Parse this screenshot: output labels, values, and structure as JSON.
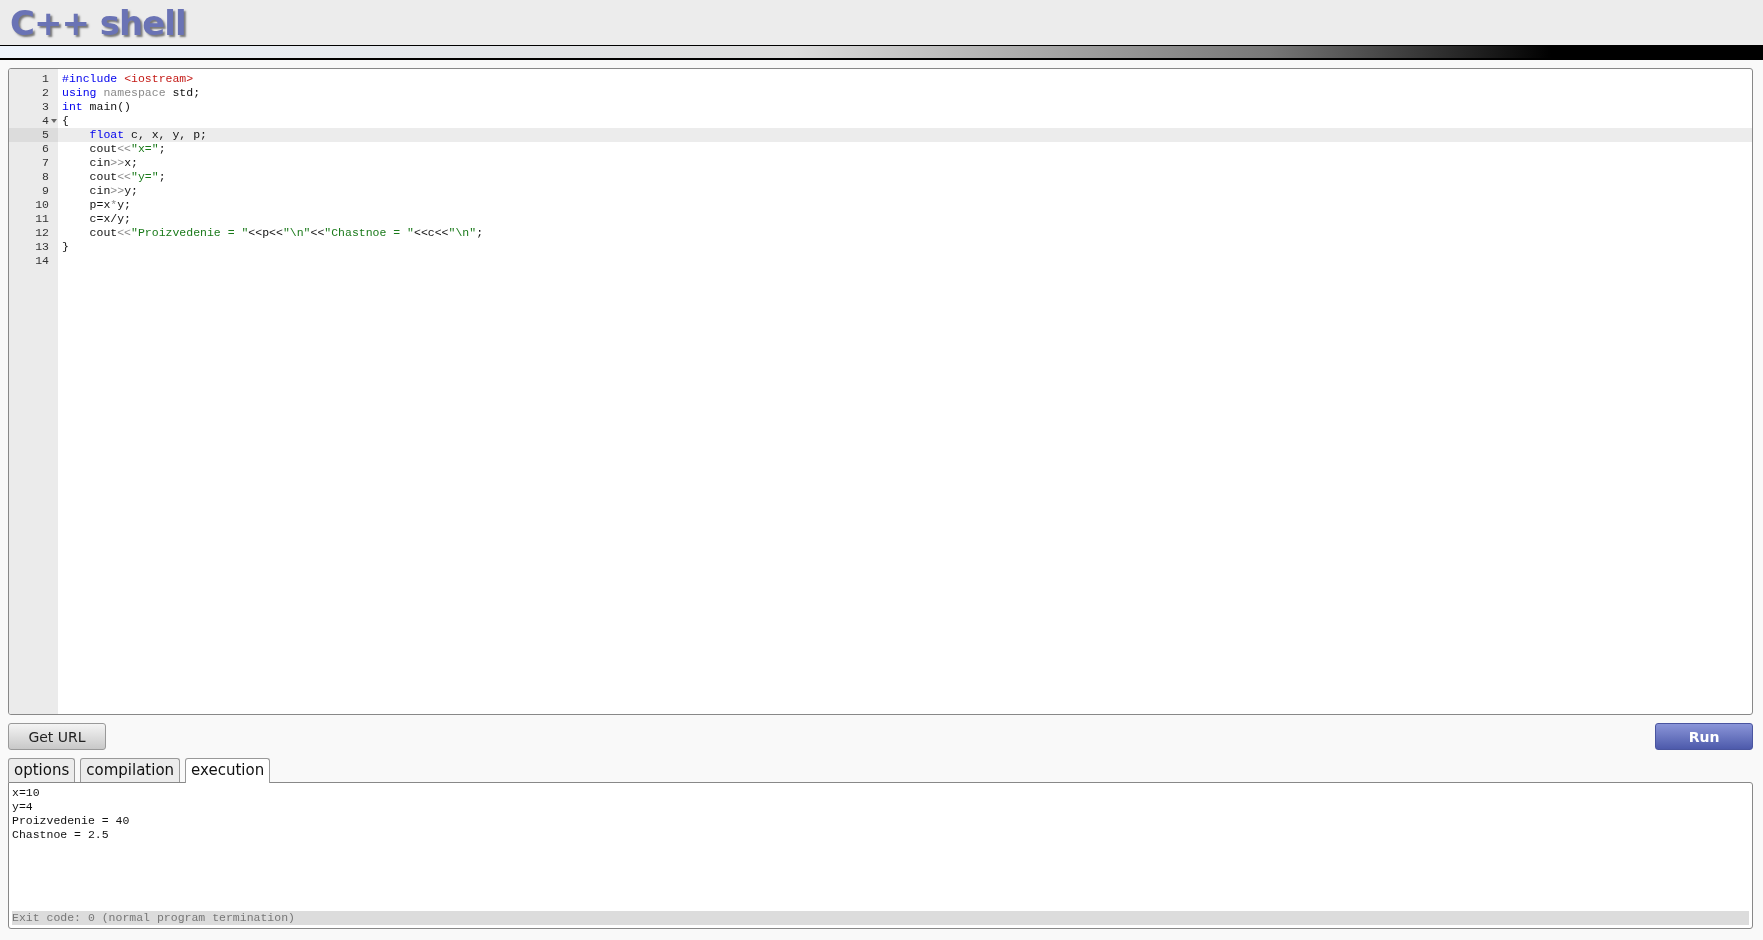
{
  "header": {
    "logo": "C++ shell"
  },
  "editor": {
    "lines": [
      {
        "number": "1",
        "kind": "plain",
        "active": false,
        "tokens": [
          {
            "kind": "keyword",
            "text": "#include "
          },
          {
            "kind": "header",
            "text": "<iostream>"
          }
        ]
      },
      {
        "number": "2",
        "kind": "plain",
        "active": false,
        "tokens": [
          {
            "kind": "keyword",
            "text": "using "
          },
          {
            "kind": "dim",
            "text": "namespace "
          },
          {
            "kind": "plain",
            "text": "std;"
          }
        ]
      },
      {
        "number": "3",
        "kind": "plain",
        "active": false,
        "tokens": [
          {
            "kind": "keyword",
            "text": "int "
          },
          {
            "kind": "plain",
            "text": "main()"
          }
        ]
      },
      {
        "number": "4",
        "kind": "fold",
        "active": false,
        "tokens": [
          {
            "kind": "plain",
            "text": "{"
          }
        ]
      },
      {
        "number": "5",
        "kind": "plain",
        "active": true,
        "tokens": [
          {
            "kind": "keyword",
            "text": "    float "
          },
          {
            "kind": "plain",
            "text": "c, x, y, p;"
          }
        ]
      },
      {
        "number": "6",
        "kind": "plain",
        "active": false,
        "tokens": [
          {
            "kind": "plain",
            "text": "    cout"
          },
          {
            "kind": "dim",
            "text": "<<"
          },
          {
            "kind": "string",
            "text": "\"x=\""
          },
          {
            "kind": "plain",
            "text": ";"
          }
        ]
      },
      {
        "number": "7",
        "kind": "plain",
        "active": false,
        "tokens": [
          {
            "kind": "plain",
            "text": "    cin"
          },
          {
            "kind": "dim",
            "text": ">>"
          },
          {
            "kind": "plain",
            "text": "x;"
          }
        ]
      },
      {
        "number": "8",
        "kind": "plain",
        "active": false,
        "tokens": [
          {
            "kind": "plain",
            "text": "    cout"
          },
          {
            "kind": "dim",
            "text": "<<"
          },
          {
            "kind": "string",
            "text": "\"y=\""
          },
          {
            "kind": "plain",
            "text": ";"
          }
        ]
      },
      {
        "number": "9",
        "kind": "plain",
        "active": false,
        "tokens": [
          {
            "kind": "plain",
            "text": "    cin"
          },
          {
            "kind": "dim",
            "text": ">>"
          },
          {
            "kind": "plain",
            "text": "y;"
          }
        ]
      },
      {
        "number": "10",
        "kind": "plain",
        "active": false,
        "tokens": [
          {
            "kind": "plain",
            "text": "    p=x"
          },
          {
            "kind": "dim",
            "text": "*"
          },
          {
            "kind": "plain",
            "text": "y;"
          }
        ]
      },
      {
        "number": "11",
        "kind": "plain",
        "active": false,
        "tokens": [
          {
            "kind": "plain",
            "text": "    c=x/y;"
          }
        ]
      },
      {
        "number": "12",
        "kind": "plain",
        "active": false,
        "tokens": [
          {
            "kind": "plain",
            "text": "    cout"
          },
          {
            "kind": "dim",
            "text": "<<"
          },
          {
            "kind": "string",
            "text": "\"Proizvedenie = \""
          },
          {
            "kind": "plain",
            "text": "<<p<<"
          },
          {
            "kind": "string",
            "text": "\"\\n\""
          },
          {
            "kind": "plain",
            "text": "<<"
          },
          {
            "kind": "string",
            "text": "\"Chastnoe = \""
          },
          {
            "kind": "plain",
            "text": "<<c<<"
          },
          {
            "kind": "string",
            "text": "\"\\n\""
          },
          {
            "kind": "plain",
            "text": ";"
          }
        ]
      },
      {
        "number": "13",
        "kind": "plain",
        "active": false,
        "tokens": [
          {
            "kind": "plain",
            "text": "}"
          }
        ]
      },
      {
        "number": "14",
        "kind": "plain",
        "active": false
      }
    ]
  },
  "buttons": {
    "get_url": "Get URL",
    "run": "Run"
  },
  "tabs": [
    {
      "label": "options",
      "selected": false
    },
    {
      "label": "compilation",
      "selected": false
    },
    {
      "label": "execution",
      "selected": true
    }
  ],
  "output": {
    "lines": [
      "x=10",
      "y=4",
      "Proizvedenie = 40",
      "Chastnoe = 2.5"
    ],
    "exit_status": "Exit code: 0 (normal program termination)"
  }
}
